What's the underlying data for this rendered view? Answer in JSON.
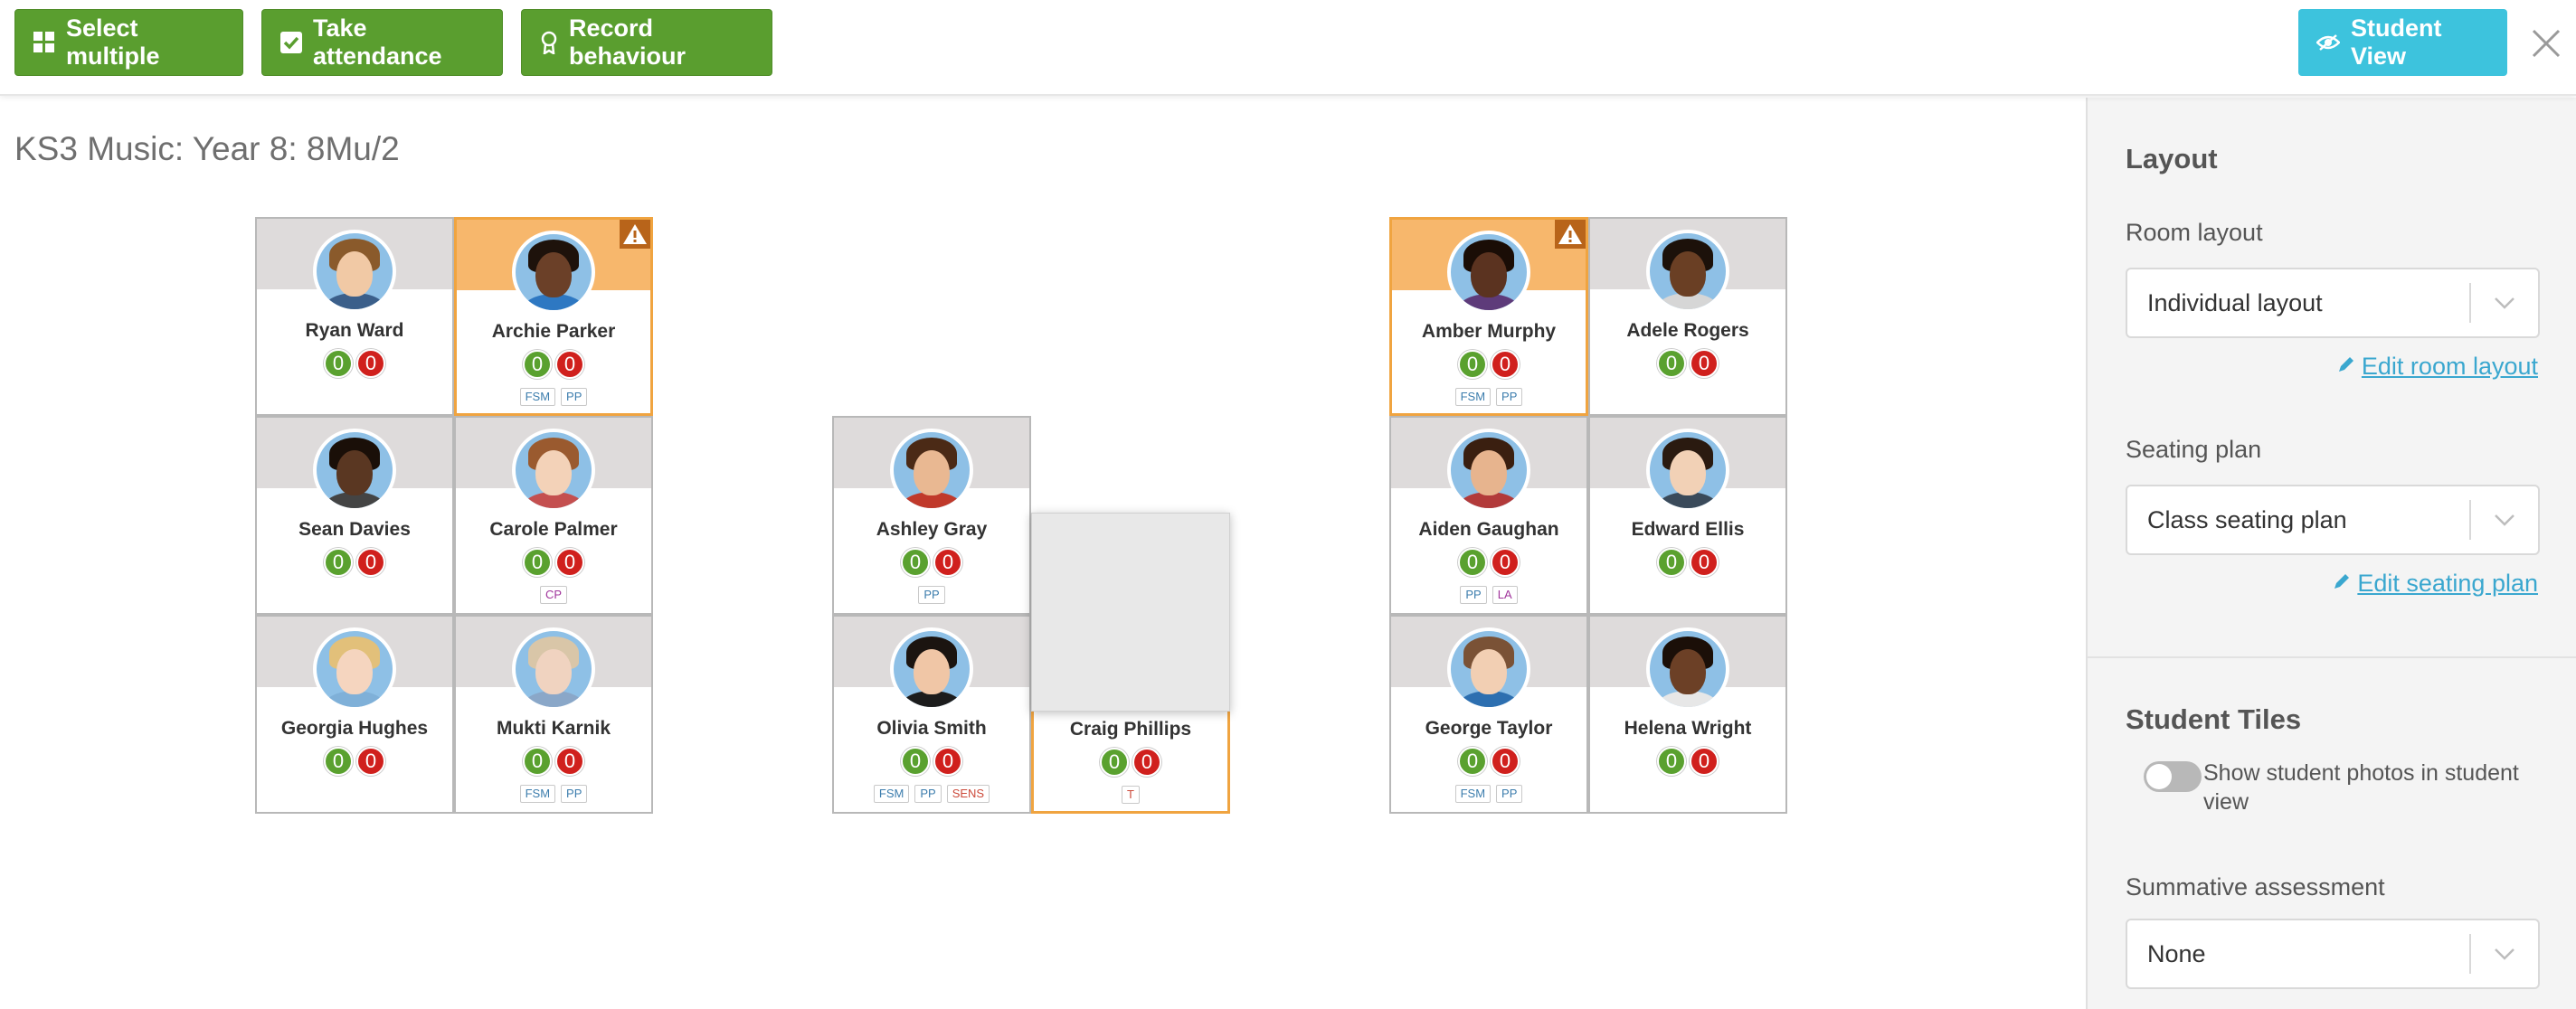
{
  "toolbar": {
    "select_multiple": "Select multiple",
    "take_attendance": "Take attendance",
    "record_behaviour": "Record behaviour",
    "student_view": "Student View",
    "colors": {
      "green": "#5a9e2f",
      "cyan": "#3dc3dd"
    }
  },
  "class_title": "KS3 Music: Year 8: 8Mu/2",
  "students": [
    {
      "name": "Ryan Ward",
      "positive": "0",
      "negative": "0",
      "tags": [],
      "flagged": false,
      "skin": "#f1c9a5",
      "hair": "#8a5a2b",
      "shirt": "#3b5f8a"
    },
    {
      "name": "Archie Parker",
      "positive": "0",
      "negative": "0",
      "tags": [
        "FSM",
        "PP"
      ],
      "flagged": true,
      "skin": "#6b4028",
      "hair": "#1e120b",
      "shirt": "#2e78c2"
    },
    {
      "name": "Sean Davies",
      "positive": "0",
      "negative": "0",
      "tags": [],
      "flagged": false,
      "skin": "#5a3722",
      "hair": "#1a0f08",
      "shirt": "#444444"
    },
    {
      "name": "Carole Palmer",
      "positive": "0",
      "negative": "0",
      "tags": [
        "CP"
      ],
      "flagged": false,
      "skin": "#f3d2b8",
      "hair": "#9a5a2f",
      "shirt": "#c44f4f"
    },
    {
      "name": "Georgia Hughes",
      "positive": "0",
      "negative": "0",
      "tags": [],
      "flagged": false,
      "skin": "#f5d5bf",
      "hair": "#e2c07a",
      "shirt": "#7fb0d8"
    },
    {
      "name": "Mukti Karnik",
      "positive": "0",
      "negative": "0",
      "tags": [
        "FSM",
        "PP"
      ],
      "flagged": false,
      "skin": "#f0d3c0",
      "hair": "#d9c6a8",
      "shirt": "#8aa7c8"
    },
    {
      "name": "Ashley Gray",
      "positive": "0",
      "negative": "0",
      "tags": [
        "PP"
      ],
      "flagged": false,
      "skin": "#e9b892",
      "hair": "#4b2a16",
      "shirt": "#c0392b"
    },
    {
      "name": "Olivia Smith",
      "positive": "0",
      "negative": "0",
      "tags": [
        "FSM",
        "PP",
        "SENS"
      ],
      "flagged": false,
      "skin": "#f0c6a6",
      "hair": "#1b1410",
      "shirt": "#1c1c1c"
    },
    {
      "name": "Craig Phillips",
      "positive": "0",
      "negative": "0",
      "tags": [
        "T"
      ],
      "flagged": true,
      "skin": "#f2caa8",
      "hair": "#6b4528",
      "shirt": "#4a6d91"
    },
    {
      "name": "Amber Murphy",
      "positive": "0",
      "negative": "0",
      "tags": [
        "FSM",
        "PP"
      ],
      "flagged": true,
      "skin": "#5b3320",
      "hair": "#1a0d06",
      "shirt": "#5e3b7a"
    },
    {
      "name": "Adele Rogers",
      "positive": "0",
      "negative": "0",
      "tags": [],
      "flagged": false,
      "skin": "#6a3f24",
      "hair": "#1c110a",
      "shirt": "#d6d6d6"
    },
    {
      "name": "Aiden Gaughan",
      "positive": "0",
      "negative": "0",
      "tags": [
        "PP",
        "LA"
      ],
      "flagged": false,
      "skin": "#e7b48e",
      "hair": "#3a1f10",
      "shirt": "#b23a3a"
    },
    {
      "name": "Edward Ellis",
      "positive": "0",
      "negative": "0",
      "tags": [],
      "flagged": false,
      "skin": "#f2d1b6",
      "hair": "#2a1a10",
      "shirt": "#3a4a5a"
    },
    {
      "name": "George Taylor",
      "positive": "0",
      "negative": "0",
      "tags": [
        "FSM",
        "PP"
      ],
      "flagged": false,
      "skin": "#f2cfb3",
      "hair": "#7a5236",
      "shirt": "#2d6fb0"
    },
    {
      "name": "Helena Wright",
      "positive": "0",
      "negative": "0",
      "tags": [],
      "flagged": false,
      "skin": "#6c4026",
      "hair": "#1b0f08",
      "shirt": "#e7e7e7"
    }
  ],
  "panel": {
    "layout_heading": "Layout",
    "room_layout_label": "Room layout",
    "room_layout_value": "Individual layout",
    "edit_room_layout": "Edit room layout",
    "seating_plan_label": "Seating plan",
    "seating_plan_value": "Class seating plan",
    "edit_seating_plan": "Edit seating plan",
    "student_tiles_heading": "Student Tiles",
    "show_photos_label": "Show student photos in student view",
    "show_photos_on": false,
    "summative_label": "Summative assessment",
    "summative_value": "None"
  }
}
